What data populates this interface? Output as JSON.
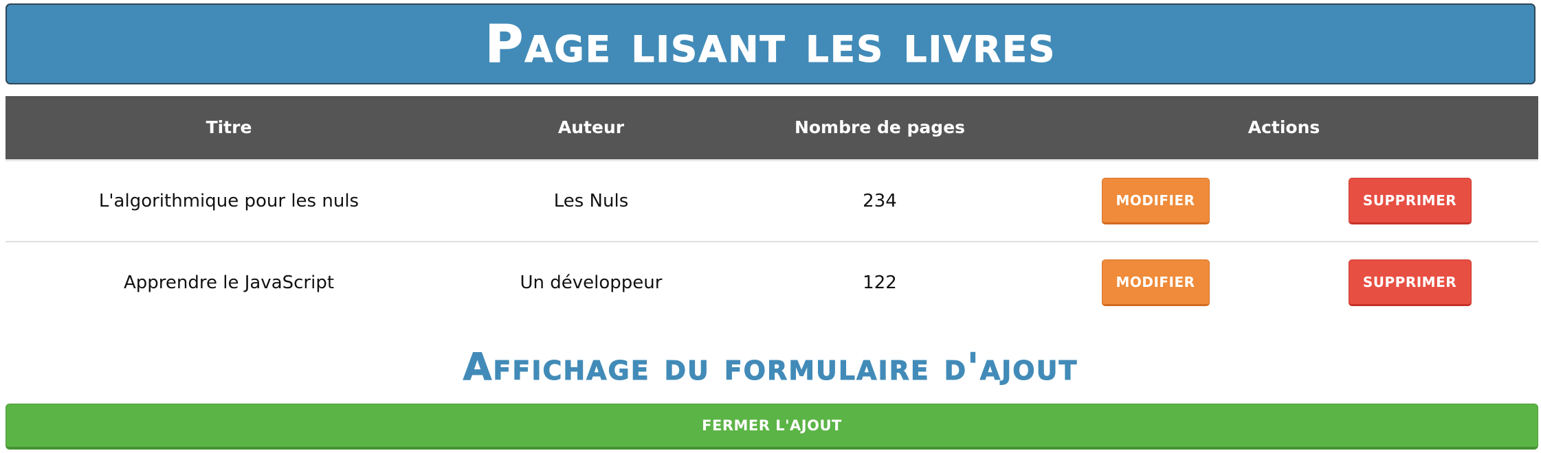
{
  "header": {
    "title": "Page lisant les livres"
  },
  "table": {
    "columns": {
      "title": "Titre",
      "author": "Auteur",
      "pages": "Nombre de pages",
      "actions": "Actions"
    },
    "rows": [
      {
        "title": "L'algorithmique pour les nuls",
        "author": "Les Nuls",
        "pages": "234",
        "modify_label": "MODIFIER",
        "delete_label": "SUPPRIMER"
      },
      {
        "title": "Apprendre le JavaScript",
        "author": "Un développeur",
        "pages": "122",
        "modify_label": "MODIFIER",
        "delete_label": "SUPPRIMER"
      }
    ]
  },
  "form_section": {
    "title": "Affichage du formulaire d'ajout",
    "close_button_label": "FERMER L'AJOUT"
  },
  "colors": {
    "header_blue": "#428bb8",
    "table_header_gray": "#555555",
    "modify_orange": "#ef8b3a",
    "delete_red": "#e84f43",
    "close_green": "#5bb446"
  }
}
